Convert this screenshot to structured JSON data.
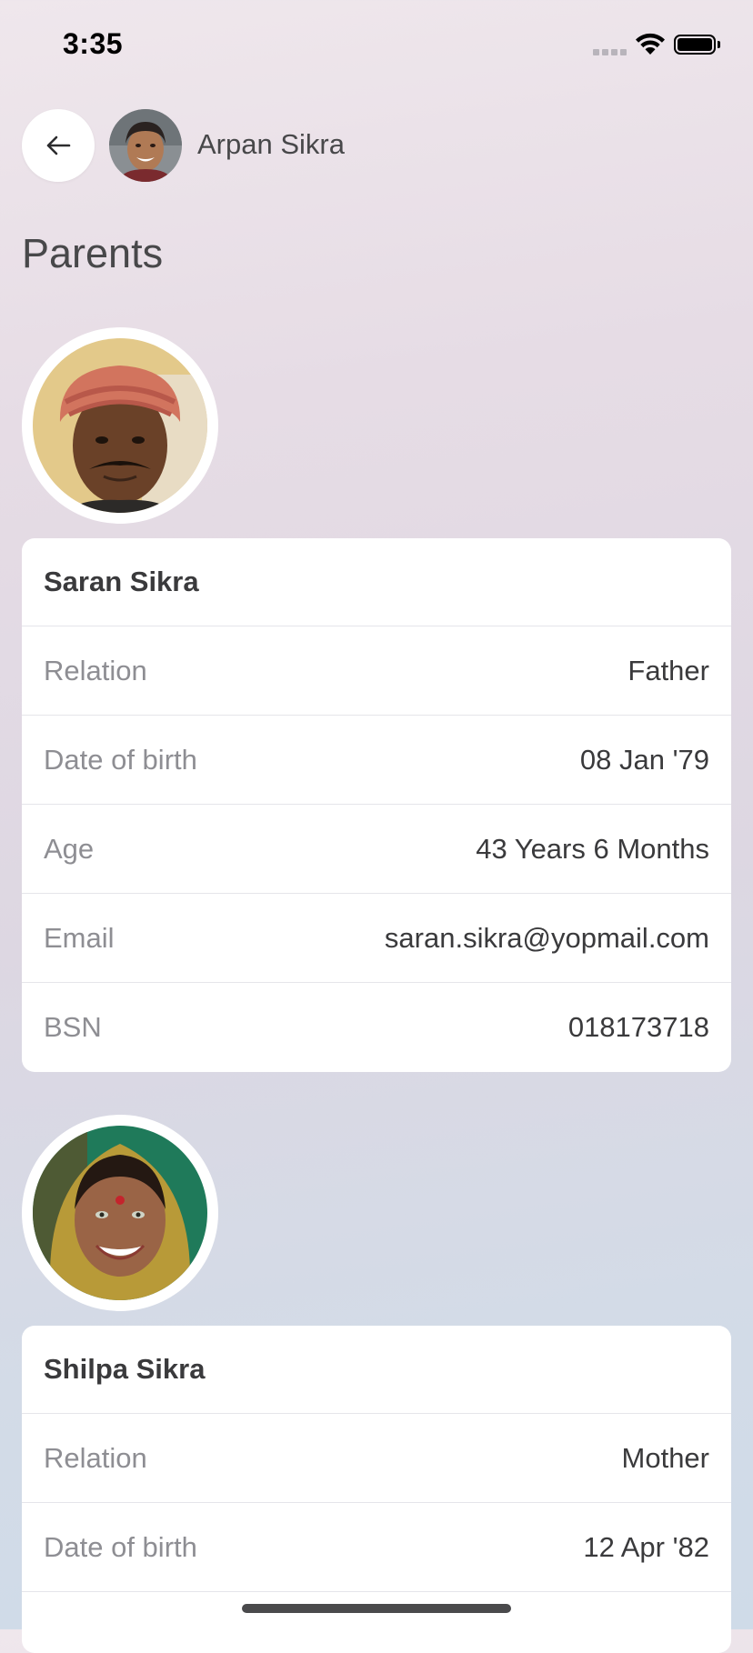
{
  "status_bar": {
    "time": "3:35"
  },
  "header": {
    "child_name": "Arpan Sikra",
    "page_title": "Parents"
  },
  "parents": [
    {
      "name": "Saran Sikra",
      "rows": [
        {
          "label": "Relation",
          "value": "Father"
        },
        {
          "label": "Date of birth",
          "value": "08 Jan '79"
        },
        {
          "label": "Age",
          "value": "43 Years 6 Months"
        },
        {
          "label": "Email",
          "value": "saran.sikra@yopmail.com"
        },
        {
          "label": "BSN",
          "value": "018173718"
        }
      ]
    },
    {
      "name": "Shilpa Sikra",
      "rows": [
        {
          "label": "Relation",
          "value": "Mother"
        },
        {
          "label": "Date of birth",
          "value": "12 Apr '82"
        }
      ]
    }
  ],
  "colors": {
    "card_background": "#ffffff",
    "label_text": "#8e8e93",
    "value_text": "#3a3a3c"
  }
}
